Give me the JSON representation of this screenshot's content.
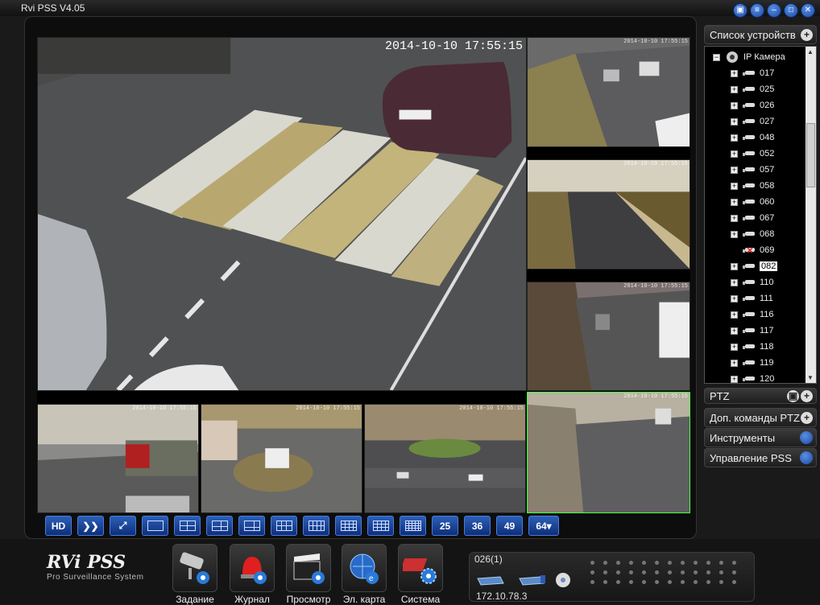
{
  "app": {
    "title": "Rvi PSS  V4.05"
  },
  "window_buttons": [
    "lock-icon",
    "list-icon",
    "minimize-icon",
    "restore-icon",
    "close-icon"
  ],
  "cameras": {
    "main": {
      "timestamp": "2014-10-10 17:55:15"
    },
    "small_timestamp": "2014-10-10 17:55:15"
  },
  "layout_buttons": [
    "HD",
    "",
    "",
    "",
    "",
    "",
    "",
    "",
    "",
    "",
    "",
    "",
    "25",
    "36",
    "49",
    "64▾"
  ],
  "logo": {
    "name": "RVi PSS",
    "tagline": "Pro Surveillance System"
  },
  "modules": [
    {
      "label": "Задание",
      "icon": "camera-task-icon"
    },
    {
      "label": "Журнал",
      "icon": "alarm-log-icon"
    },
    {
      "label": "Просмотр",
      "icon": "playback-icon"
    },
    {
      "label": "Эл. карта",
      "icon": "emap-icon"
    },
    {
      "label": "Система",
      "icon": "system-icon"
    }
  ],
  "status": {
    "channel": "026(1)",
    "ip": "172.10.78.3"
  },
  "sidebar": {
    "device_list_title": "Список устройств",
    "tree_root": "IP Камера",
    "devices": [
      "017",
      "025",
      "026",
      "027",
      "048",
      "052",
      "057",
      "058",
      "060",
      "067",
      "068",
      "069",
      "082",
      "110",
      "111",
      "116",
      "117",
      "118",
      "119",
      "120"
    ],
    "selected_device": "082",
    "offline_device": "069",
    "panels": [
      "PTZ",
      "Доп. команды PTZ",
      "Инструменты",
      "Управление PSS"
    ]
  }
}
